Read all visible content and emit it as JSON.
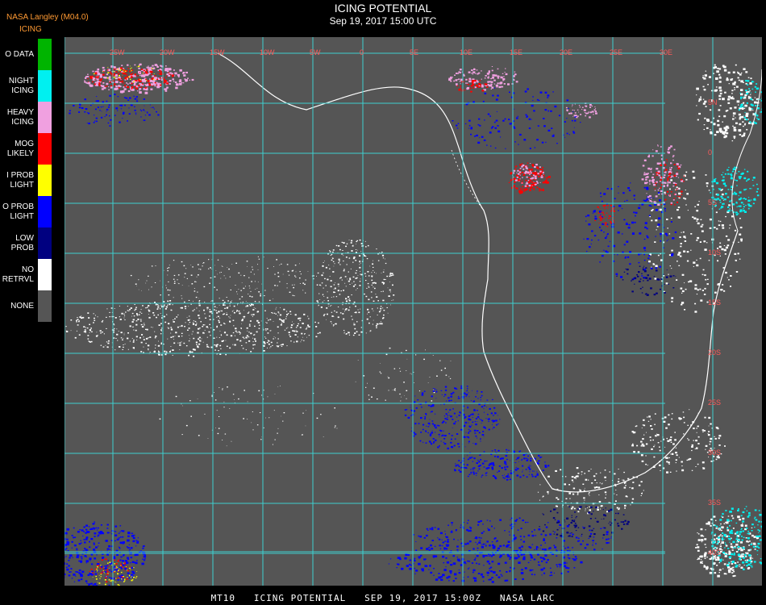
{
  "header": {
    "source": "NASA Langley (M04.0)",
    "title": "ICING POTENTIAL",
    "datetime": "Sep 19, 2017 15:00 UTC",
    "product": "ICING"
  },
  "legend": [
    {
      "label": "O DATA",
      "color": "#00b400"
    },
    {
      "label": "NIGHT\nICING",
      "color": "#00f0f0"
    },
    {
      "label": "HEAVY\nICING",
      "color": "#f0a0e0"
    },
    {
      "label": "MOG\nLIKELY",
      "color": "#ff0000"
    },
    {
      "label": "I PROB\nLIGHT",
      "color": "#ffff00"
    },
    {
      "label": "O PROB\nLIGHT",
      "color": "#0000ff"
    },
    {
      "label": "LOW\nPROB",
      "color": "#000080"
    },
    {
      "label": "NO\nRETRVL",
      "color": "#ffffff"
    },
    {
      "label": "NONE",
      "color": "#555555"
    }
  ],
  "map": {
    "background_color": "#555555",
    "grid_color": "#3fd0d0",
    "coast_color": "#ffffff",
    "lon_labels": [
      "25W",
      "20W",
      "15W",
      "10W",
      "5W",
      "0",
      "5E",
      "10E",
      "15E",
      "20E",
      "25E",
      "30E"
    ],
    "lat_labels": [
      "5N",
      "0",
      "5S",
      "10S",
      "15S",
      "20S",
      "25S",
      "30S",
      "35S",
      "40S"
    ],
    "label_color": "#ff5a5a"
  },
  "footer": "MT10   ICING POTENTIAL   SEP 19, 2017 15:00Z   NASA LARC"
}
